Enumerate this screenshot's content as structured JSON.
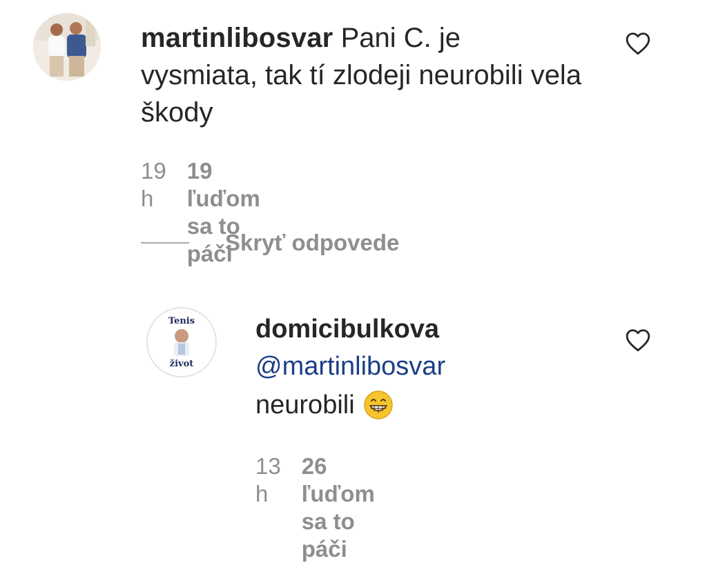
{
  "comments": [
    {
      "username": "martinlibosvar",
      "text": "Pani C. je vysmiata, tak tí zlodeji neurobili vela škody",
      "time": "19 h",
      "likes": "19 ľuďom sa to páči",
      "icons": {
        "like": "heart-outline-icon"
      }
    }
  ],
  "replies_toggle": {
    "label": "Skryť odpovede"
  },
  "reply": {
    "username": "domicibulkova",
    "mention": "@martinlibosvar",
    "text": "neurobili",
    "time": "13 h",
    "likes": "26 ľuďom sa to páči",
    "avatar_text_top": "Tenis",
    "avatar_text_bottom": "život",
    "icons": {
      "like": "heart-outline-icon",
      "emoji": "grinning-face-emoji"
    }
  },
  "colors": {
    "text": "#262626",
    "secondary": "#8e8e8e",
    "mention": "#1c3f86",
    "emoji": "#f6c52d"
  }
}
